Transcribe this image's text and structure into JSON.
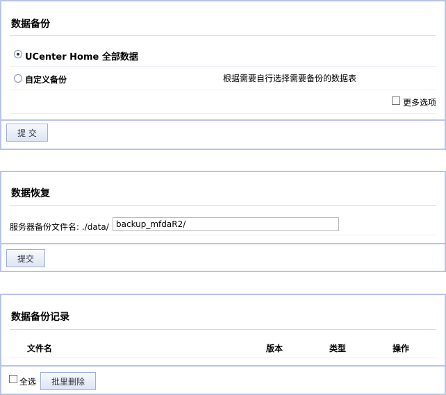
{
  "backup": {
    "title": "数据备份",
    "options": [
      {
        "label": "UCenter Home 全部数据",
        "checked": true
      },
      {
        "label": "自定义备份",
        "checked": false,
        "hint": "根据需要自行选择需要备份的数据表"
      }
    ],
    "more_options_label": "更多选项",
    "submit_label": "提 交"
  },
  "restore": {
    "title": "数据恢复",
    "file_label": "服务器备份文件名: ./data/",
    "file_value": "backup_mfdaR2/",
    "submit_label": "提交"
  },
  "records": {
    "title": "数据备份记录",
    "columns": [
      "文件名",
      "版本",
      "类型",
      "操作"
    ],
    "select_all_label": "全选",
    "batch_delete_label": "批里删除"
  }
}
